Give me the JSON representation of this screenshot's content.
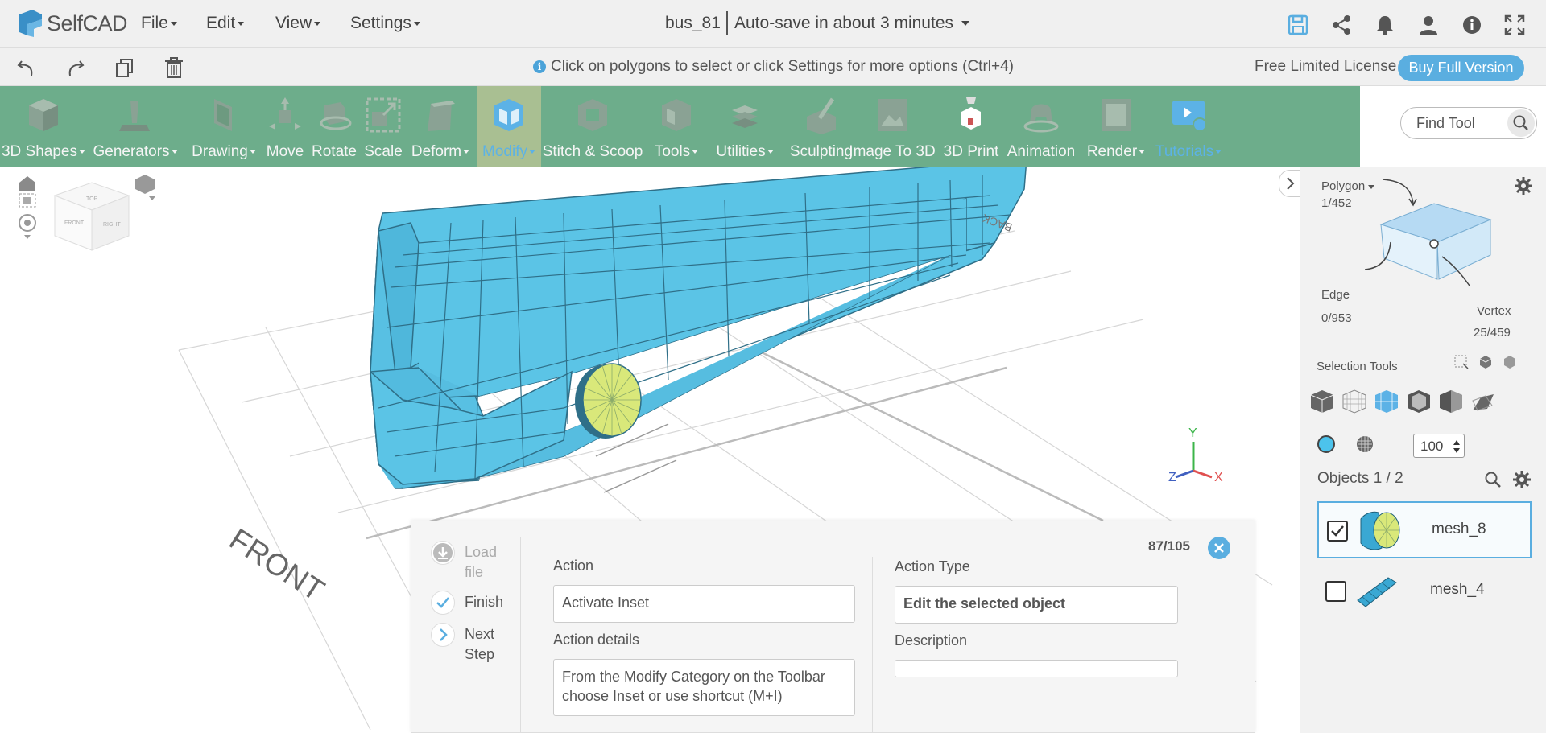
{
  "app": {
    "name": "SelfCAD"
  },
  "menu": [
    {
      "label": "File"
    },
    {
      "label": "Edit"
    },
    {
      "label": "View"
    },
    {
      "label": "Settings"
    }
  ],
  "project": {
    "name": "bus_81",
    "autosave": "Auto-save in about 3 minutes"
  },
  "hint": "Click on polygons to select or click Settings for more options (Ctrl+4)",
  "license": {
    "text": "Free Limited License",
    "buy_label": "Buy Full Version"
  },
  "toolbar": [
    {
      "label": "3D Shapes",
      "icon": "cube-icon",
      "dropdown": true
    },
    {
      "label": "Generators",
      "icon": "generators-icon",
      "dropdown": true
    },
    {
      "label": "Drawing",
      "icon": "drawing-icon",
      "dropdown": true
    },
    {
      "label": "Move",
      "icon": "move-icon",
      "dropdown": false
    },
    {
      "label": "Rotate",
      "icon": "rotate-icon",
      "dropdown": false
    },
    {
      "label": "Scale",
      "icon": "scale-icon",
      "dropdown": false
    },
    {
      "label": "Deform",
      "icon": "deform-icon",
      "dropdown": true
    },
    {
      "label": "Modify",
      "icon": "modify-icon",
      "dropdown": true,
      "active": true
    },
    {
      "label": "Stitch & Scoop",
      "icon": "stitch-scoop-icon",
      "dropdown": false
    },
    {
      "label": "Tools",
      "icon": "tools-icon",
      "dropdown": true
    },
    {
      "label": "Utilities",
      "icon": "utilities-icon",
      "dropdown": true
    },
    {
      "label": "Sculpting",
      "icon": "sculpting-icon",
      "dropdown": false
    },
    {
      "label": "Image To 3D",
      "icon": "image-to-3d-icon",
      "dropdown": false
    },
    {
      "label": "3D Print",
      "icon": "3d-print-icon",
      "dropdown": false
    },
    {
      "label": "Animation",
      "icon": "animation-icon",
      "dropdown": false
    },
    {
      "label": "Render",
      "icon": "render-icon",
      "dropdown": true
    },
    {
      "label": "Tutorials",
      "icon": "tutorials-icon",
      "dropdown": true,
      "tutorial": true
    }
  ],
  "find_tool": {
    "placeholder": "Find Tool"
  },
  "viewport": {
    "front_label": "FRONT",
    "back_label": "BACK",
    "axis": {
      "x": "X",
      "y": "Y",
      "z": "Z"
    },
    "cube_faces": {
      "top": "TOP",
      "front": "FRONT",
      "right": "RIGHT"
    }
  },
  "selection": {
    "mode": "Polygon",
    "polygon_count": "1/452",
    "edge_label": "Edge",
    "edge_count": "0/953",
    "vertex_label": "Vertex",
    "vertex_count": "25/459",
    "tools_label": "Selection Tools",
    "opacity": "100"
  },
  "objects": {
    "title": "Objects 1 / 2",
    "items": [
      {
        "name": "mesh_8",
        "checked": true
      },
      {
        "name": "mesh_4",
        "checked": false
      }
    ]
  },
  "tutorial_dialog": {
    "load_file": "Load file",
    "finish": "Finish",
    "next_step": "Next Step",
    "counter": "87/105",
    "action_label": "Action",
    "action_value": "Activate Inset",
    "action_details_label": "Action details",
    "action_details_value": "From the Modify Category on the Toolbar choose Inset or use shortcut (M+I)",
    "action_type_label": "Action Type",
    "action_type_value": "Edit the selected object",
    "description_label": "Description",
    "description_value": ""
  },
  "colors": {
    "toolbar_bg": "#6dad8b",
    "active_tool_bg": "#a9bf92",
    "accent": "#5aaee0",
    "mesh": "#5bc4e6",
    "wheel": "#d9e87a"
  }
}
